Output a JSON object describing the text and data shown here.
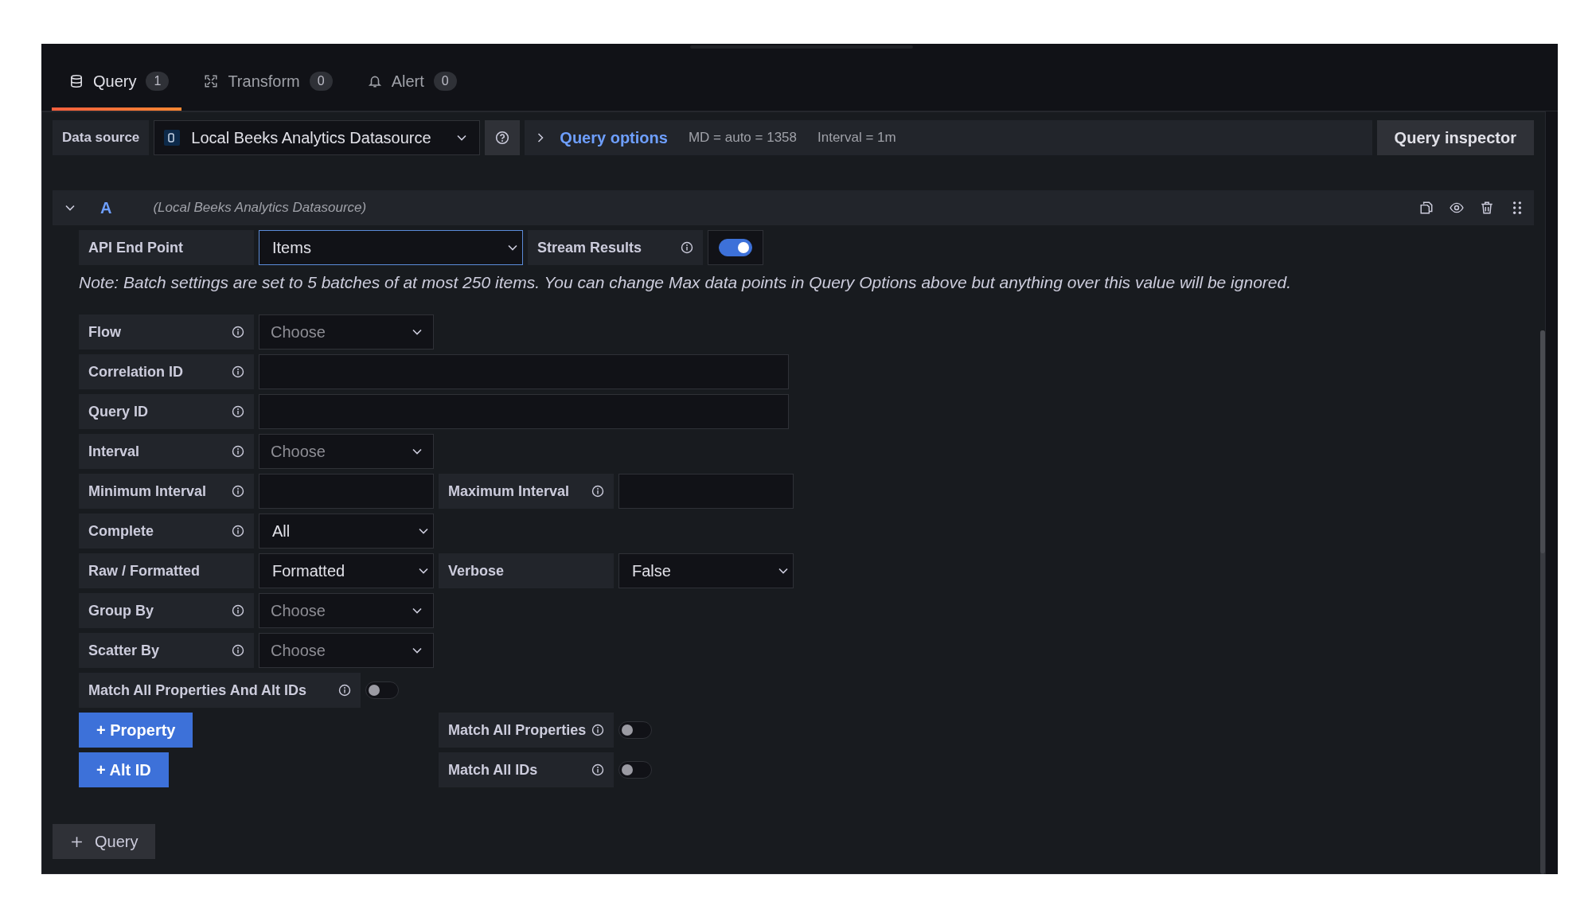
{
  "tabs": [
    {
      "label": "Query",
      "count": "1",
      "selected": true
    },
    {
      "label": "Transform",
      "count": "0",
      "selected": false
    },
    {
      "label": "Alert",
      "count": "0",
      "selected": false
    }
  ],
  "datasource_bar": {
    "label": "Data source",
    "datasource": "Local Beeks Analytics Datasource",
    "options_link": "Query options",
    "max_data_points": "MD = auto = 1358",
    "interval": "Interval = 1m",
    "inspector_button": "Query inspector"
  },
  "query": {
    "ref_id": "A",
    "datasource_note": "(Local Beeks Analytics Datasource)",
    "expanded": true,
    "endpoint": {
      "label": "API End Point",
      "value": "Items"
    },
    "stream": {
      "label": "Stream Results",
      "on": true
    },
    "note": "Note: Batch settings are set to 5 batches of at most 250 items. You can change Max data points in Query Options above but anything over this value will be ignored.",
    "rows": [
      {
        "fields": [
          {
            "label": "Flow",
            "info": true,
            "kind": "select",
            "placeholder": "Choose"
          }
        ]
      },
      {
        "fields": [
          {
            "label": "Correlation ID",
            "info": true,
            "kind": "wide-text"
          }
        ]
      },
      {
        "fields": [
          {
            "label": "Query ID",
            "info": true,
            "kind": "wide-text"
          }
        ]
      },
      {
        "fields": [
          {
            "label": "Interval",
            "info": true,
            "kind": "select",
            "placeholder": "Choose"
          }
        ]
      },
      {
        "fields": [
          {
            "label": "Minimum Interval",
            "info": true,
            "kind": "text"
          },
          {
            "label": "Maximum Interval",
            "info": true,
            "kind": "text"
          }
        ]
      },
      {
        "fields": [
          {
            "label": "Complete",
            "info": true,
            "kind": "native-select",
            "value": "All"
          }
        ]
      },
      {
        "fields": [
          {
            "label": "Raw / Formatted",
            "info": false,
            "kind": "native-select",
            "value": "Formatted"
          },
          {
            "label": "Verbose",
            "info": false,
            "kind": "native-select",
            "value": "False"
          }
        ]
      },
      {
        "fields": [
          {
            "label": "Group By",
            "info": true,
            "kind": "select",
            "placeholder": "Choose"
          }
        ]
      },
      {
        "fields": [
          {
            "label": "Scatter By",
            "info": true,
            "kind": "select",
            "placeholder": "Choose"
          }
        ]
      },
      {
        "fields": [
          {
            "label": "Match All Properties And Alt IDs",
            "info": true,
            "kind": "wide-toggle",
            "on": false
          }
        ]
      }
    ],
    "actions": [
      {
        "button": "+ Property",
        "toggle": {
          "label": "Match All Properties",
          "info": true,
          "on": false
        }
      },
      {
        "button": "+ Alt ID",
        "toggle": {
          "label": "Match All IDs",
          "info": true,
          "on": false
        }
      }
    ]
  },
  "add_query_button": "Query"
}
